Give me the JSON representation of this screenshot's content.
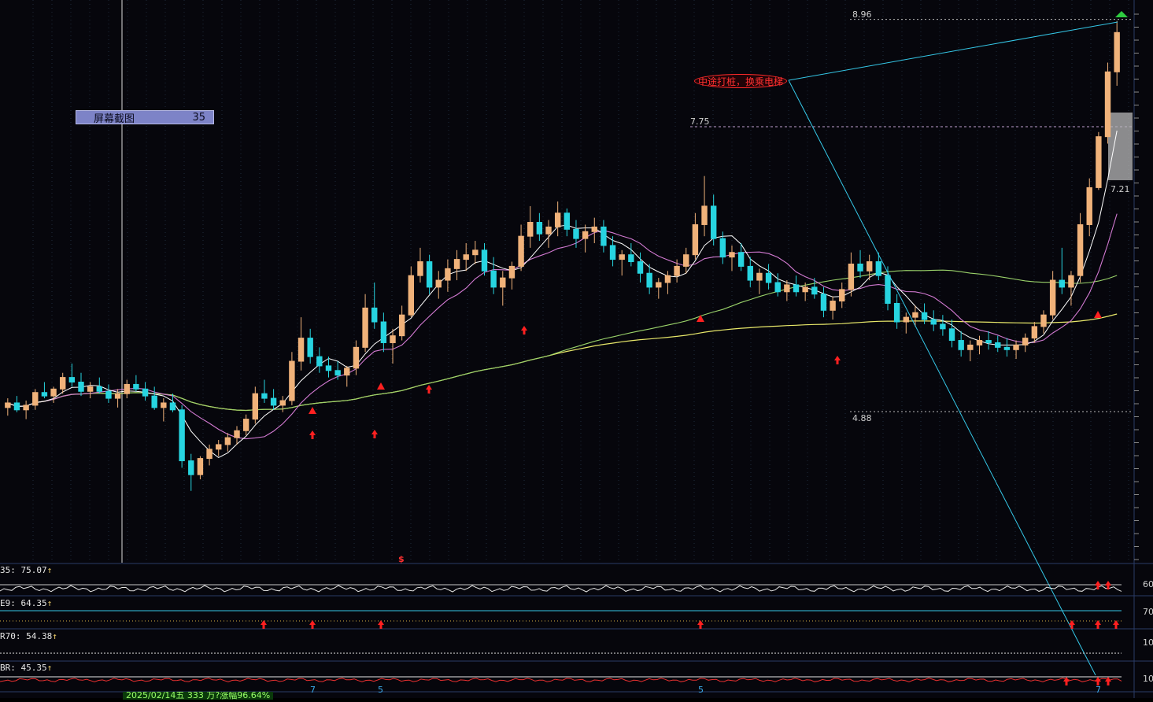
{
  "chart_data": {
    "type": "candlestick",
    "main_pane": {
      "price_labels": {
        "high_marker": "8.96",
        "level_mid": "7.75",
        "level_low": "4.88",
        "last_box": "7.21"
      },
      "annotation_callout": "中途打桩，换乘电梯",
      "signal_letter": "$",
      "candles": [
        [
          5.62,
          5.7,
          5.55,
          5.66
        ],
        [
          5.66,
          5.72,
          5.58,
          5.6
        ],
        [
          5.6,
          5.68,
          5.52,
          5.64
        ],
        [
          5.64,
          5.78,
          5.6,
          5.75
        ],
        [
          5.75,
          5.84,
          5.7,
          5.72
        ],
        [
          5.72,
          5.8,
          5.66,
          5.78
        ],
        [
          5.78,
          5.92,
          5.74,
          5.88
        ],
        [
          5.88,
          6.0,
          5.8,
          5.84
        ],
        [
          5.84,
          5.92,
          5.72,
          5.76
        ],
        [
          5.76,
          5.84,
          5.7,
          5.8
        ],
        [
          5.8,
          5.88,
          5.74,
          5.76
        ],
        [
          5.76,
          5.82,
          5.66,
          5.7
        ],
        [
          5.7,
          5.78,
          5.62,
          5.74
        ],
        [
          5.74,
          5.86,
          5.7,
          5.82
        ],
        [
          5.82,
          5.9,
          5.76,
          5.78
        ],
        [
          5.78,
          5.84,
          5.68,
          5.72
        ],
        [
          5.72,
          5.8,
          5.6,
          5.62
        ],
        [
          5.62,
          5.7,
          5.5,
          5.66
        ],
        [
          5.66,
          5.74,
          5.58,
          5.6
        ],
        [
          5.6,
          5.64,
          5.1,
          5.16
        ],
        [
          5.16,
          5.22,
          4.9,
          5.04
        ],
        [
          5.04,
          5.2,
          5.0,
          5.18
        ],
        [
          5.18,
          5.3,
          5.12,
          5.26
        ],
        [
          5.26,
          5.34,
          5.2,
          5.3
        ],
        [
          5.3,
          5.4,
          5.24,
          5.36
        ],
        [
          5.36,
          5.46,
          5.3,
          5.42
        ],
        [
          5.42,
          5.56,
          5.38,
          5.52
        ],
        [
          5.52,
          5.8,
          5.48,
          5.74
        ],
        [
          5.74,
          5.86,
          5.66,
          5.7
        ],
        [
          5.7,
          5.78,
          5.6,
          5.64
        ],
        [
          5.64,
          5.72,
          5.58,
          5.68
        ],
        [
          5.68,
          6.1,
          5.64,
          6.02
        ],
        [
          6.02,
          6.4,
          5.94,
          6.22
        ],
        [
          6.22,
          6.3,
          6.0,
          6.06
        ],
        [
          6.06,
          6.14,
          5.92,
          5.98
        ],
        [
          5.98,
          6.06,
          5.88,
          5.94
        ],
        [
          5.94,
          6.02,
          5.86,
          5.9
        ],
        [
          5.9,
          5.98,
          5.8,
          5.96
        ],
        [
          5.96,
          6.2,
          5.9,
          6.14
        ],
        [
          6.14,
          6.6,
          6.1,
          6.48
        ],
        [
          6.48,
          6.7,
          6.3,
          6.36
        ],
        [
          6.36,
          6.44,
          6.1,
          6.18
        ],
        [
          6.18,
          6.3,
          6.0,
          6.24
        ],
        [
          6.24,
          6.5,
          6.2,
          6.42
        ],
        [
          6.42,
          6.84,
          6.4,
          6.76
        ],
        [
          6.76,
          7.0,
          6.7,
          6.88
        ],
        [
          6.88,
          6.94,
          6.6,
          6.66
        ],
        [
          6.66,
          6.8,
          6.56,
          6.72
        ],
        [
          6.72,
          6.9,
          6.62,
          6.82
        ],
        [
          6.82,
          6.98,
          6.72,
          6.9
        ],
        [
          6.9,
          7.04,
          6.8,
          6.94
        ],
        [
          6.94,
          7.06,
          6.86,
          6.98
        ],
        [
          6.98,
          7.04,
          6.76,
          6.8
        ],
        [
          6.8,
          6.92,
          6.6,
          6.66
        ],
        [
          6.66,
          6.8,
          6.5,
          6.74
        ],
        [
          6.74,
          6.88,
          6.64,
          6.84
        ],
        [
          6.84,
          7.2,
          6.8,
          7.1
        ],
        [
          7.1,
          7.36,
          7.0,
          7.22
        ],
        [
          7.22,
          7.3,
          7.06,
          7.12
        ],
        [
          7.12,
          7.24,
          7.0,
          7.18
        ],
        [
          7.18,
          7.4,
          7.1,
          7.3
        ],
        [
          7.3,
          7.34,
          7.1,
          7.16
        ],
        [
          7.16,
          7.24,
          7.0,
          7.08
        ],
        [
          7.08,
          7.2,
          6.96,
          7.14
        ],
        [
          7.14,
          7.26,
          7.04,
          7.18
        ],
        [
          7.18,
          7.24,
          6.96,
          7.02
        ],
        [
          7.02,
          7.1,
          6.84,
          6.9
        ],
        [
          6.9,
          6.98,
          6.76,
          6.94
        ],
        [
          6.94,
          7.04,
          6.84,
          6.88
        ],
        [
          6.88,
          6.96,
          6.7,
          6.78
        ],
        [
          6.78,
          6.86,
          6.6,
          6.66
        ],
        [
          6.66,
          6.74,
          6.56,
          6.7
        ],
        [
          6.7,
          6.8,
          6.6,
          6.76
        ],
        [
          6.76,
          6.9,
          6.7,
          6.84
        ],
        [
          6.84,
          7.0,
          6.78,
          6.94
        ],
        [
          6.94,
          7.3,
          6.9,
          7.2
        ],
        [
          7.2,
          7.62,
          7.1,
          7.36
        ],
        [
          7.36,
          7.46,
          7.02,
          7.08
        ],
        [
          7.08,
          7.14,
          6.86,
          6.92
        ],
        [
          6.92,
          7.02,
          6.8,
          6.96
        ],
        [
          6.96,
          7.04,
          6.8,
          6.84
        ],
        [
          6.84,
          6.92,
          6.66,
          6.72
        ],
        [
          6.72,
          6.82,
          6.6,
          6.78
        ],
        [
          6.78,
          6.86,
          6.64,
          6.7
        ],
        [
          6.7,
          6.78,
          6.58,
          6.62
        ],
        [
          6.62,
          6.72,
          6.54,
          6.68
        ],
        [
          6.68,
          6.76,
          6.58,
          6.62
        ],
        [
          6.62,
          6.7,
          6.54,
          6.66
        ],
        [
          6.66,
          6.74,
          6.56,
          6.6
        ],
        [
          6.6,
          6.66,
          6.4,
          6.46
        ],
        [
          6.46,
          6.58,
          6.38,
          6.54
        ],
        [
          6.54,
          6.7,
          6.48,
          6.64
        ],
        [
          6.64,
          6.96,
          6.58,
          6.86
        ],
        [
          6.86,
          6.98,
          6.74,
          6.8
        ],
        [
          6.8,
          6.94,
          6.72,
          6.88
        ],
        [
          6.88,
          6.96,
          6.72,
          6.76
        ],
        [
          6.76,
          6.84,
          6.46,
          6.52
        ],
        [
          6.52,
          6.6,
          6.3,
          6.36
        ],
        [
          6.36,
          6.44,
          6.26,
          6.4
        ],
        [
          6.4,
          6.5,
          6.32,
          6.44
        ],
        [
          6.44,
          6.52,
          6.34,
          6.38
        ],
        [
          6.38,
          6.46,
          6.28,
          6.34
        ],
        [
          6.34,
          6.42,
          6.24,
          6.3
        ],
        [
          6.3,
          6.38,
          6.14,
          6.2
        ],
        [
          6.2,
          6.28,
          6.06,
          6.12
        ],
        [
          6.12,
          6.2,
          6.02,
          6.16
        ],
        [
          6.16,
          6.24,
          6.08,
          6.2
        ],
        [
          6.2,
          6.28,
          6.12,
          6.18
        ],
        [
          6.18,
          6.24,
          6.1,
          6.14
        ],
        [
          6.14,
          6.22,
          6.06,
          6.12
        ],
        [
          6.12,
          6.2,
          6.04,
          6.16
        ],
        [
          6.16,
          6.26,
          6.1,
          6.22
        ],
        [
          6.22,
          6.36,
          6.18,
          6.32
        ],
        [
          6.32,
          6.46,
          6.26,
          6.42
        ],
        [
          6.42,
          6.8,
          6.38,
          6.72
        ],
        [
          6.72,
          7.0,
          6.6,
          6.66
        ],
        [
          6.66,
          6.8,
          6.5,
          6.76
        ],
        [
          6.76,
          7.3,
          6.7,
          7.2
        ],
        [
          7.2,
          7.6,
          7.1,
          7.52
        ],
        [
          7.52,
          8.0,
          7.5,
          7.96
        ],
        [
          7.96,
          8.6,
          7.9,
          8.52
        ],
        [
          8.52,
          8.96,
          8.4,
          8.86
        ]
      ]
    },
    "sub_panes": [
      {
        "label": "35: 75.07",
        "right_tick": "60"
      },
      {
        "label": "E9: 64.35",
        "right_tick": "70"
      },
      {
        "label": "R70: 54.38",
        "right_tick": "10"
      },
      {
        "label": "BR: 45.35",
        "right_tick": "10"
      }
    ],
    "x_markers": [
      "7",
      "5",
      "5",
      "7"
    ],
    "footer_text": "2025/02/14五 333 万?涨幅96.64%"
  },
  "screenshot_box": {
    "label": "屏幕截图",
    "count": "35"
  },
  "colors": {
    "up": "#f0b27a",
    "down": "#27d4e0",
    "ma_short": "#ffffff",
    "ma_mid": "#d27ad2",
    "ma_long": "#9ad26a",
    "ma_yearly": "#e8e86a",
    "trend": "#35c8e8",
    "signal": "#ff2020"
  }
}
